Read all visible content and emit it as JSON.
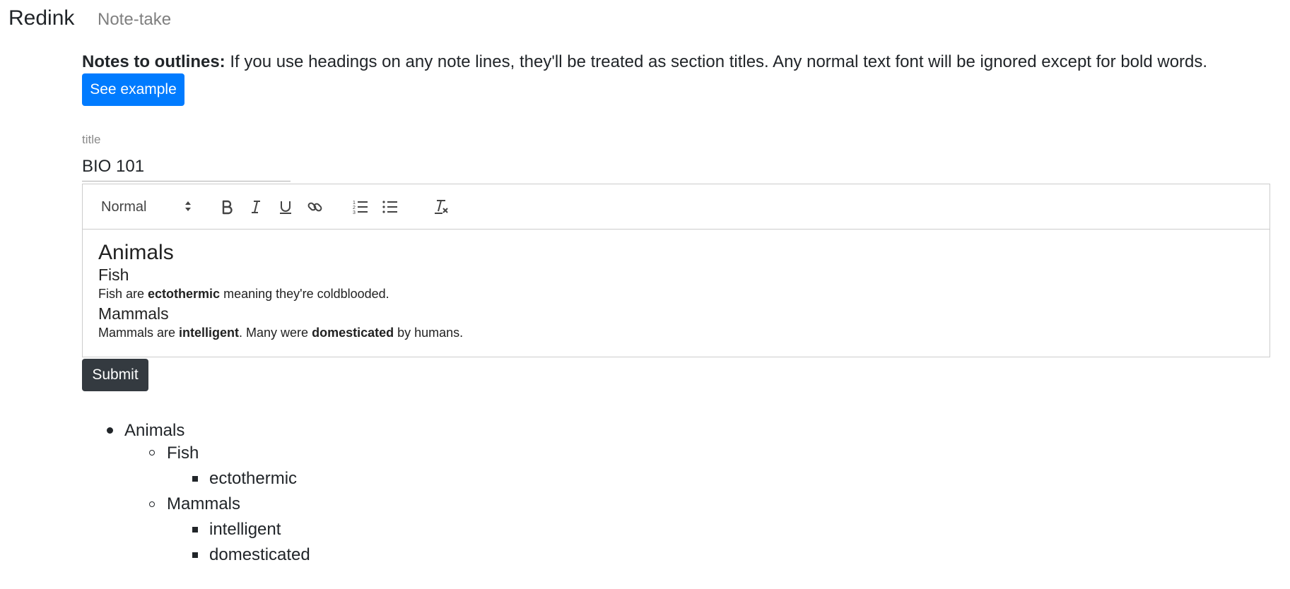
{
  "navbar": {
    "brand": "Redink",
    "links": [
      "Note-take"
    ]
  },
  "instructions": {
    "bold": "Notes to outlines:",
    "text": " If you use headings on any note lines, they'll be treated as section titles. Any normal text font will be ignored except for bold words."
  },
  "buttons": {
    "see_example": "See example",
    "submit": "Submit"
  },
  "title_field": {
    "label": "title",
    "value": "BIO 101"
  },
  "toolbar": {
    "format_select": "Normal",
    "icons": [
      "bold-icon",
      "italic-icon",
      "underline-icon",
      "link-icon",
      "ordered-list-icon",
      "bullet-list-icon",
      "clear-format-icon"
    ]
  },
  "editor_content": {
    "h1": "Animals",
    "fish_heading": "Fish",
    "fish_line": {
      "pre": "Fish are ",
      "bold": "ectothermic",
      "post": " meaning they're coldblooded."
    },
    "mammals_heading": "Mammals",
    "mammals_line": {
      "pre": "Mammals are ",
      "bold1": "intelligent",
      "mid": ". Many were ",
      "bold2": "domesticated",
      "post": " by humans."
    }
  },
  "outline": {
    "root": "Animals",
    "fish": "Fish",
    "fish_items": [
      "ectothermic"
    ],
    "mammals": "Mammals",
    "mammals_items": [
      "intelligent",
      "domesticated"
    ]
  },
  "colors": {
    "primary": "#007bff",
    "dark": "#343a40",
    "text": "#212529",
    "muted": "#7f7f7f"
  }
}
